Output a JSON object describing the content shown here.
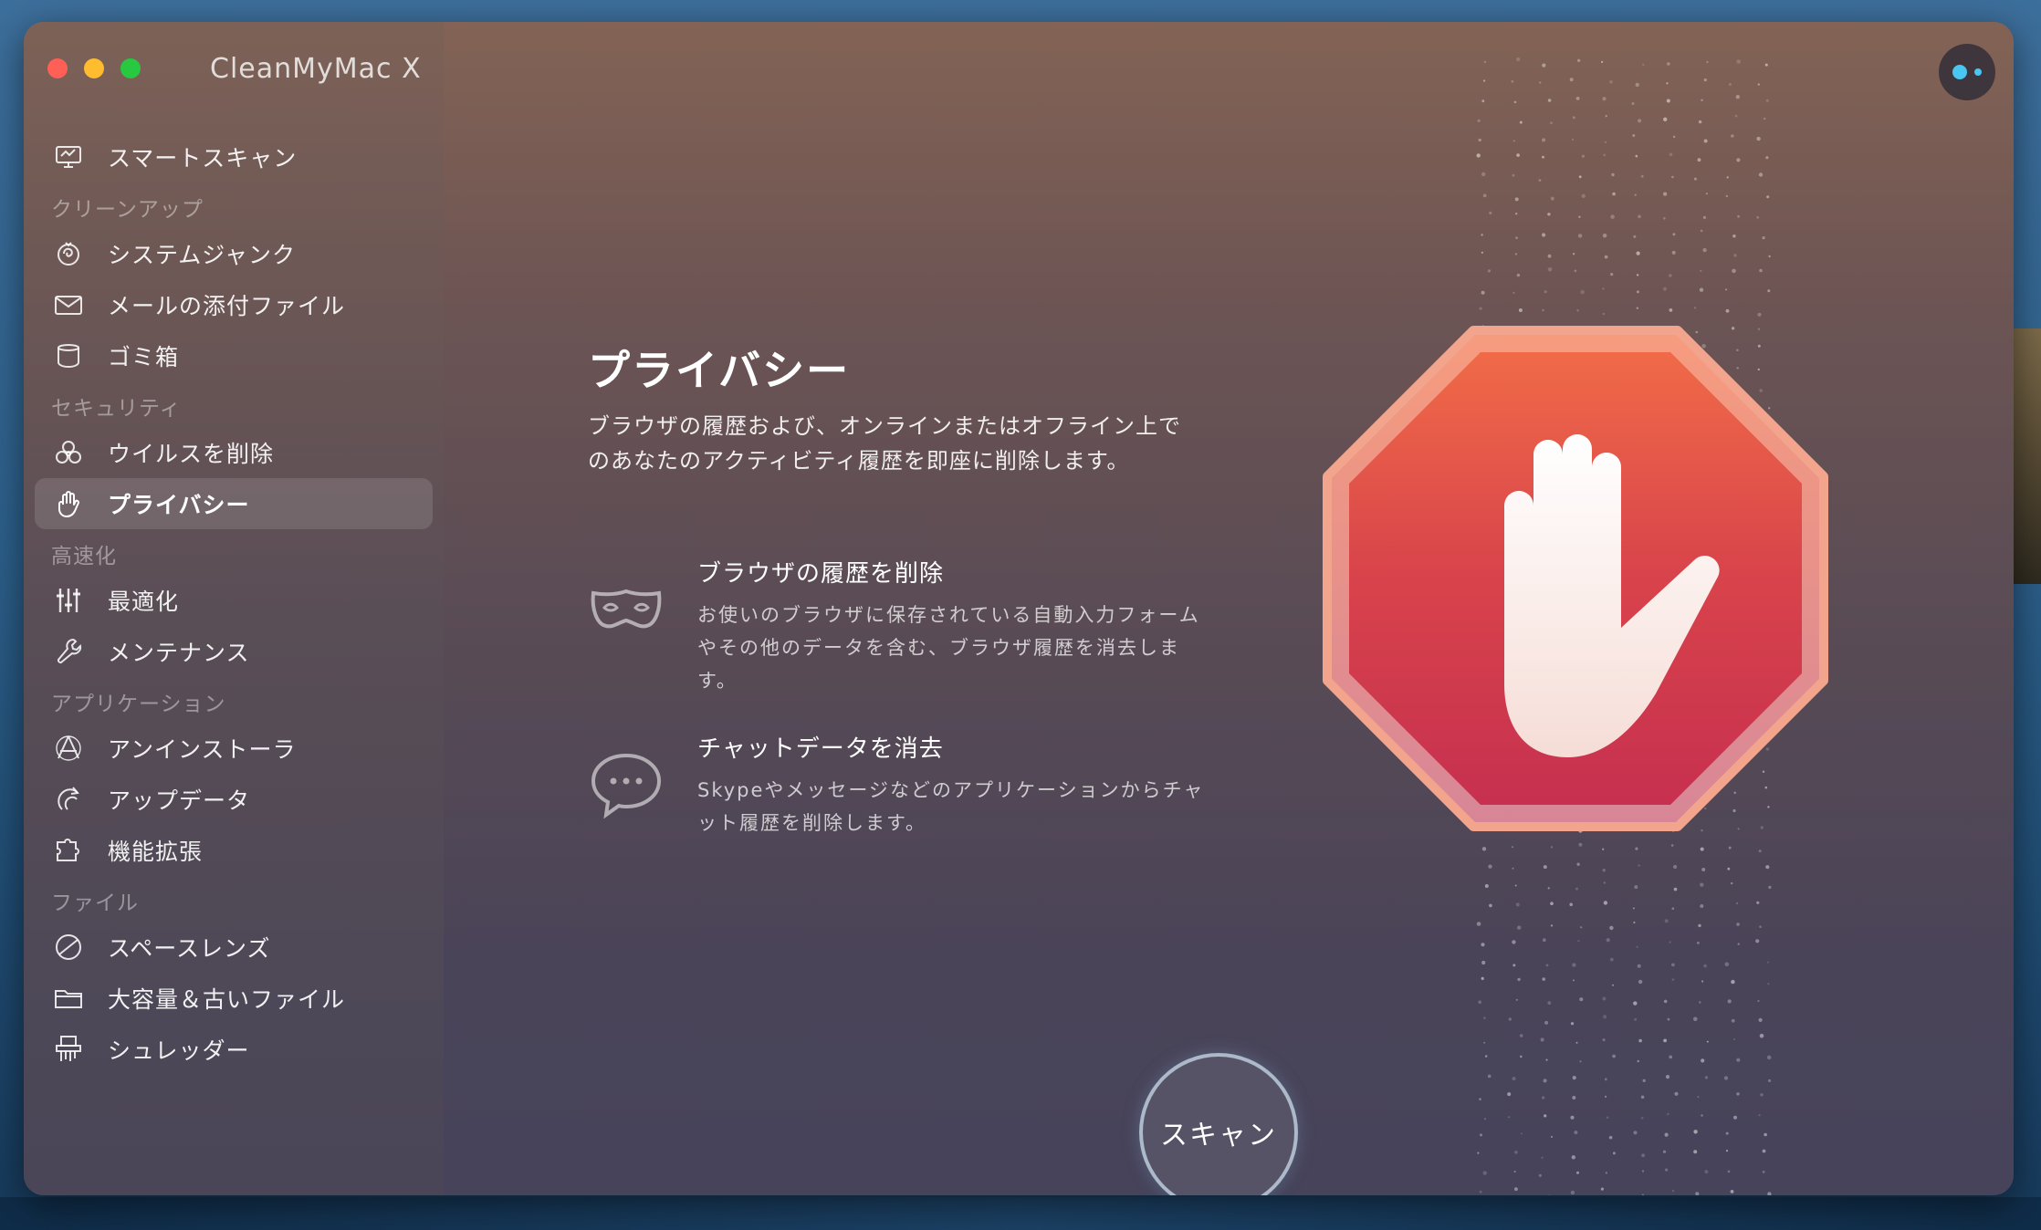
{
  "app": {
    "title": "CleanMyMac X"
  },
  "sidebar": {
    "top_item": {
      "label": "スマートスキャン",
      "icon": "monitor-icon"
    },
    "sections": [
      {
        "title": "クリーンアップ",
        "items": [
          {
            "label": "システムジャンク",
            "icon": "system-junk-icon"
          },
          {
            "label": "メールの添付ファイル",
            "icon": "mail-icon"
          },
          {
            "label": "ゴミ箱",
            "icon": "trash-icon"
          }
        ]
      },
      {
        "title": "セキュリティ",
        "items": [
          {
            "label": "ウイルスを削除",
            "icon": "biohazard-icon"
          },
          {
            "label": "プライバシー",
            "icon": "hand-icon",
            "active": true
          }
        ]
      },
      {
        "title": "高速化",
        "items": [
          {
            "label": "最適化",
            "icon": "sliders-icon"
          },
          {
            "label": "メンテナンス",
            "icon": "wrench-icon"
          }
        ]
      },
      {
        "title": "アプリケーション",
        "items": [
          {
            "label": "アンインストーラ",
            "icon": "uninstaller-icon"
          },
          {
            "label": "アップデータ",
            "icon": "updater-icon"
          },
          {
            "label": "機能拡張",
            "icon": "extension-icon"
          }
        ]
      },
      {
        "title": "ファイル",
        "items": [
          {
            "label": "スペースレンズ",
            "icon": "space-lens-icon"
          },
          {
            "label": "大容量＆古いファイル",
            "icon": "folder-icon"
          },
          {
            "label": "シュレッダー",
            "icon": "shredder-icon"
          }
        ]
      }
    ]
  },
  "main": {
    "heading": "プライバシー",
    "intro_line1": "ブラウザの履歴および、オンラインまたはオフライン上で",
    "intro_line2": "のあなたのアクティビティ履歴を即座に削除します。",
    "features": [
      {
        "icon": "mask-icon",
        "title": "ブラウザの履歴を削除",
        "desc_line1": "お使いのブラウザに保存されている自動入力フォーム",
        "desc_line2": "やその他のデータを含む、ブラウザ履歴を消去しま",
        "desc_line3": "す。"
      },
      {
        "icon": "chat-bubble-icon",
        "title": "チャットデータを消去",
        "desc_line1": "Skypeやメッセージなどのアプリケーションからチャ",
        "desc_line2": "ット履歴を削除します。"
      }
    ],
    "hero_icon": "stop-hand-icon"
  },
  "scan_button": {
    "label": "スキャン"
  },
  "colors": {
    "accent_dot": "#49c6f2",
    "stop_sign_top": "#f06a48",
    "stop_sign_bottom": "#c7304f"
  }
}
